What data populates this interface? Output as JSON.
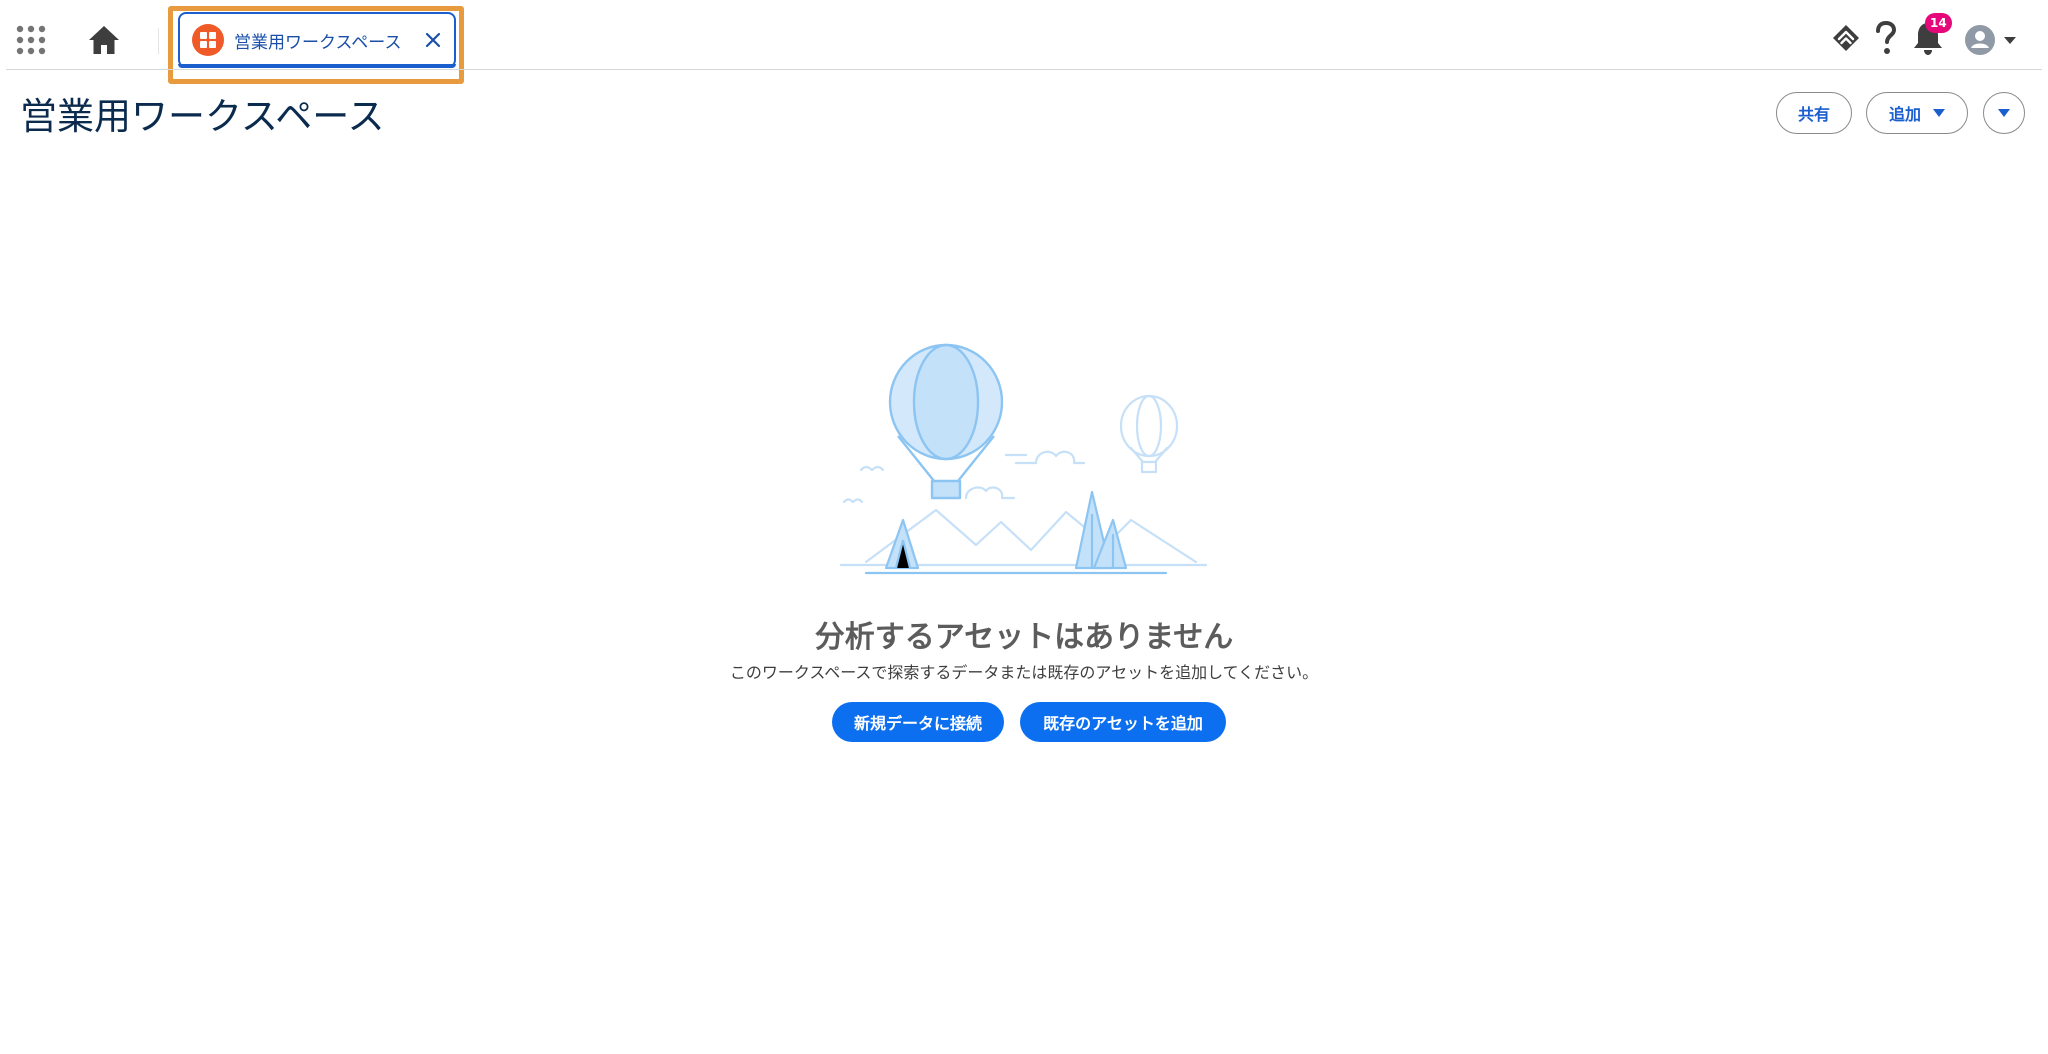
{
  "tab": {
    "label": "営業用ワークスペース",
    "icon": "workspace-icon",
    "close_icon": "close-icon"
  },
  "topbar": {
    "app_launcher_icon": "app-launcher-icon",
    "home_icon": "home-icon",
    "utilities": {
      "assistant_icon": "assistant-icon",
      "help_icon": "help-icon",
      "notifications_icon": "bell-icon",
      "notifications_count": "14",
      "avatar_icon": "avatar-icon"
    }
  },
  "page": {
    "title": "営業用ワークスペース",
    "actions": {
      "share": "共有",
      "add": "追加"
    }
  },
  "empty_state": {
    "title": "分析するアセットはありません",
    "description": "このワークスペースで探索するデータまたは既存のアセットを追加してください。",
    "connect_button": "新規データに接続",
    "add_existing_button": "既存のアセットを追加"
  },
  "colors": {
    "brand_blue": "#0b6ff0",
    "tab_blue": "#1b5fcf",
    "highlight_orange": "#e89a3f",
    "badge_pink": "#e6077a",
    "tab_icon_orange": "#f05a28"
  }
}
